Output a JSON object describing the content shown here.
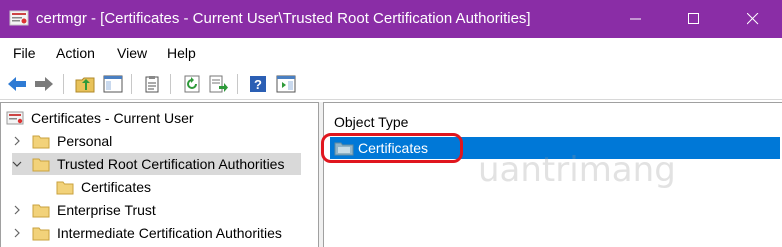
{
  "window": {
    "title": "certmgr - [Certificates - Current User\\Trusted Root Certification Authorities]",
    "title_bar_color": "#8a2da6"
  },
  "menu": {
    "items": [
      "File",
      "Action",
      "View",
      "Help"
    ]
  },
  "toolbar": {
    "icons": [
      "back-arrow-icon",
      "forward-arrow-icon",
      "up-folder-icon",
      "show-hide-tree-icon",
      "properties-icon",
      "refresh-icon",
      "export-list-icon",
      "help-icon",
      "action-pane-icon"
    ]
  },
  "tree": {
    "root_label": "Certificates - Current User",
    "items": [
      {
        "label": "Personal",
        "expanded": false
      },
      {
        "label": "Trusted Root Certification Authorities",
        "expanded": true,
        "selected": true
      },
      {
        "label": "Certificates",
        "child": true
      },
      {
        "label": "Enterprise Trust",
        "expanded": false
      },
      {
        "label": "Intermediate Certification Authorities",
        "expanded": false
      }
    ]
  },
  "list": {
    "column_header": "Object Type",
    "rows": [
      {
        "label": "Certificates",
        "selected": true
      }
    ],
    "selection_color": "#0078d7",
    "highlight_color": "#e0161e"
  },
  "watermark": {
    "text": "uantrimang"
  }
}
